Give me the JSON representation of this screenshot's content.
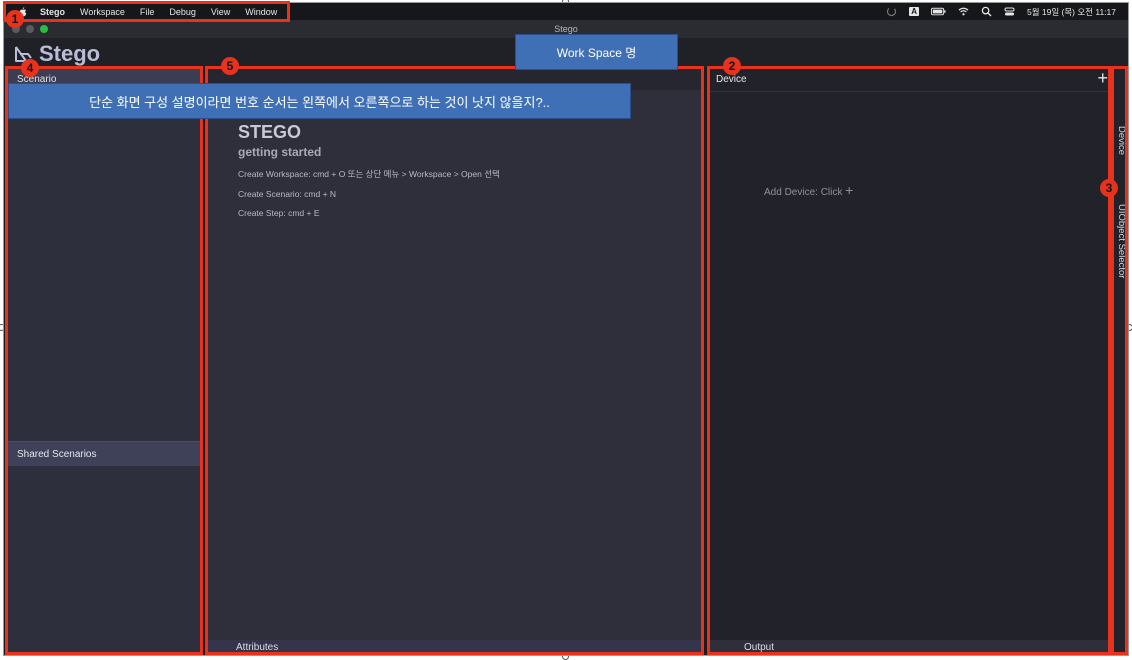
{
  "menubar": {
    "app_name": "Stego",
    "items": [
      "Workspace",
      "File",
      "Debug",
      "View",
      "Window"
    ],
    "status": {
      "input_indicator": "A",
      "datetime": "5월 19일 (목) 오전 11:17"
    }
  },
  "window": {
    "title": "Stego"
  },
  "app": {
    "logo_text": "Stego"
  },
  "left_pane": {
    "scenario_header": "Scenario",
    "shared_header": "Shared Scenarios"
  },
  "center_pane": {
    "heading": "STEGO",
    "subheading": "getting started",
    "shortcuts": [
      "Create Workspace: cmd + O 또는 상단 메뉴 > Workspace > Open 선택",
      "Create Scenario: cmd + N",
      "Create Step: cmd + E"
    ],
    "attributes_label": "Attributes"
  },
  "right_pane": {
    "device_header": "Device",
    "add_device_text": "Add Device: Click",
    "output_label": "Output"
  },
  "side_tabs": {
    "device": "Device",
    "uiobject_selector": "UIObject Selector"
  },
  "annotations": {
    "badges": [
      "1",
      "2",
      "3",
      "4",
      "5"
    ],
    "workspace_callout": "Work Space 명",
    "note_callout": "단순 화면 구성 설명이라면 번호 순서는 왼쪽에서 오른쪽으로 하는 것이 낫지 않을지?.."
  },
  "colors": {
    "annotation_red": "#e8321c",
    "callout_blue": "#3f6fb5",
    "app_background": "#1b1c22",
    "panel_header": "#3b3d52"
  }
}
